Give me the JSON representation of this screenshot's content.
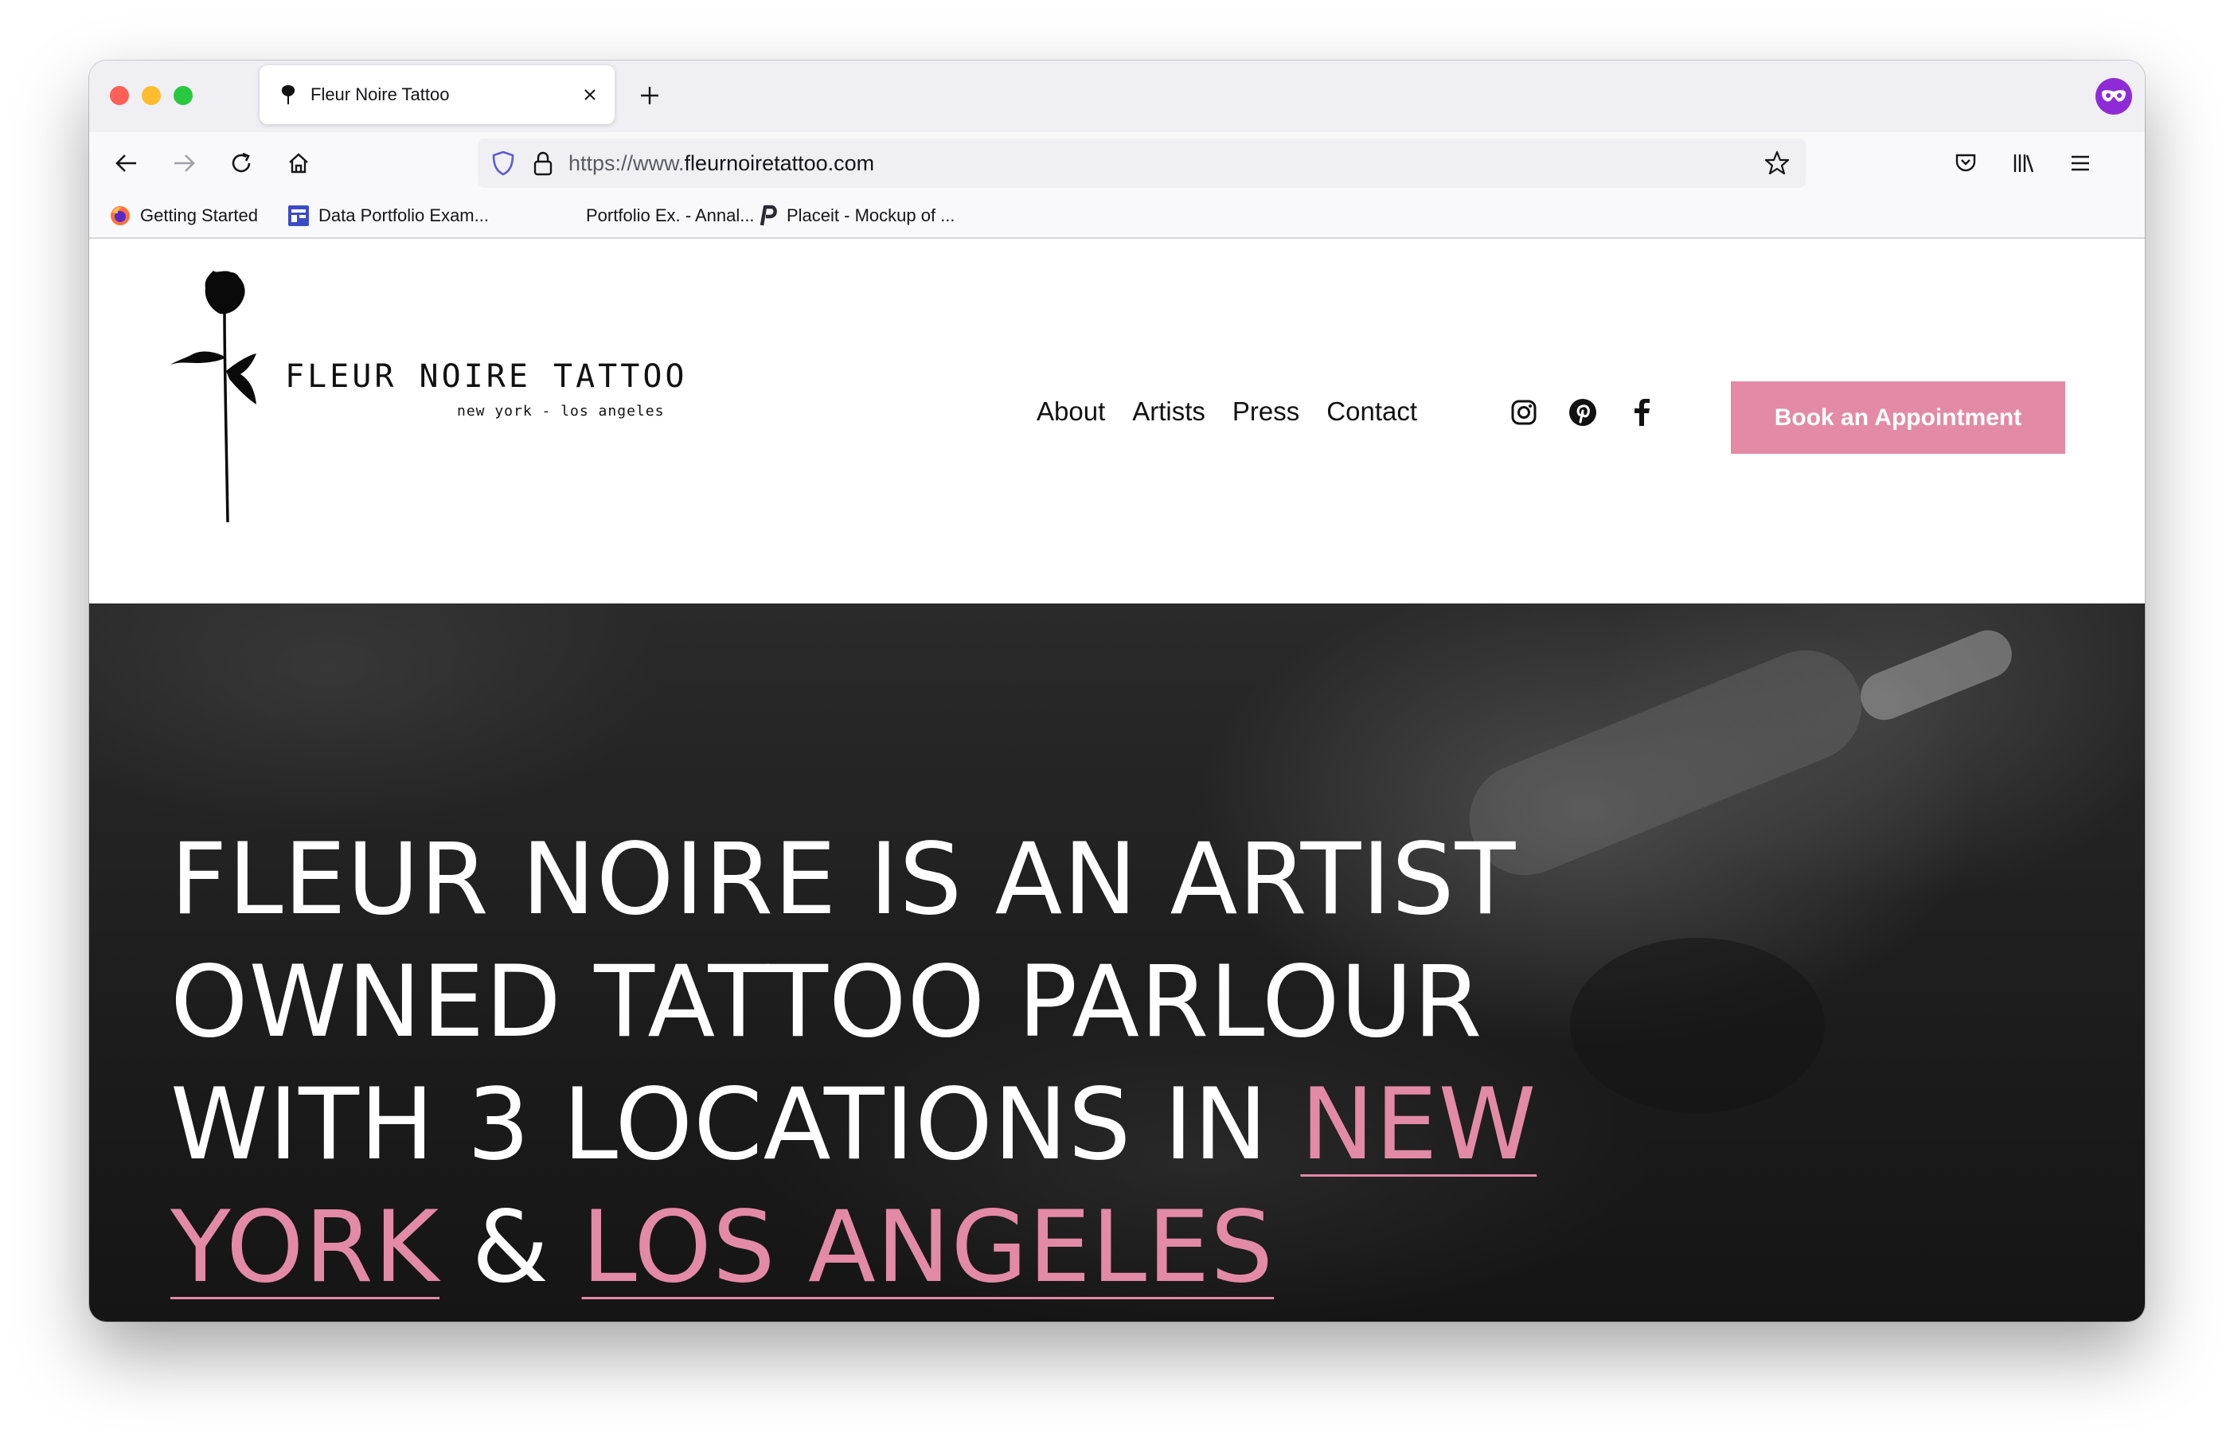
{
  "browser": {
    "tab_title": "Fleur Noire Tattoo",
    "new_tab_symbol": "+",
    "url_protocol": "https://www.",
    "url_host": "fleurnoiretattoo.com",
    "bookmarks": [
      {
        "label": "Getting Started",
        "icon": "firefox-icon"
      },
      {
        "label": "Data Portfolio Exam...",
        "icon": "layout-icon"
      },
      {
        "label": "Portfolio Ex. - Annal...",
        "icon": "none"
      },
      {
        "label": "Placeit - Mockup of ...",
        "icon": "placeit-icon"
      }
    ]
  },
  "site": {
    "brand": "FLEUR NOIRE TATTOO",
    "tagline": "new york - los angeles",
    "nav": [
      "About",
      "Artists",
      "Press",
      "Contact"
    ],
    "socials": [
      "instagram-icon",
      "pinterest-icon",
      "facebook-icon"
    ],
    "cta_label": "Book an Appointment",
    "accent_color": "#e38aa6"
  },
  "hero": {
    "line1": "FLEUR NOIRE IS AN ARTIST",
    "line2": "OWNED TATTOO PARLOUR",
    "line3_prefix": "WITH 3 LOCATIONS IN ",
    "accent_1": "NEW YORK",
    "connector": " & ",
    "accent_2": "LOS ANGELES"
  }
}
